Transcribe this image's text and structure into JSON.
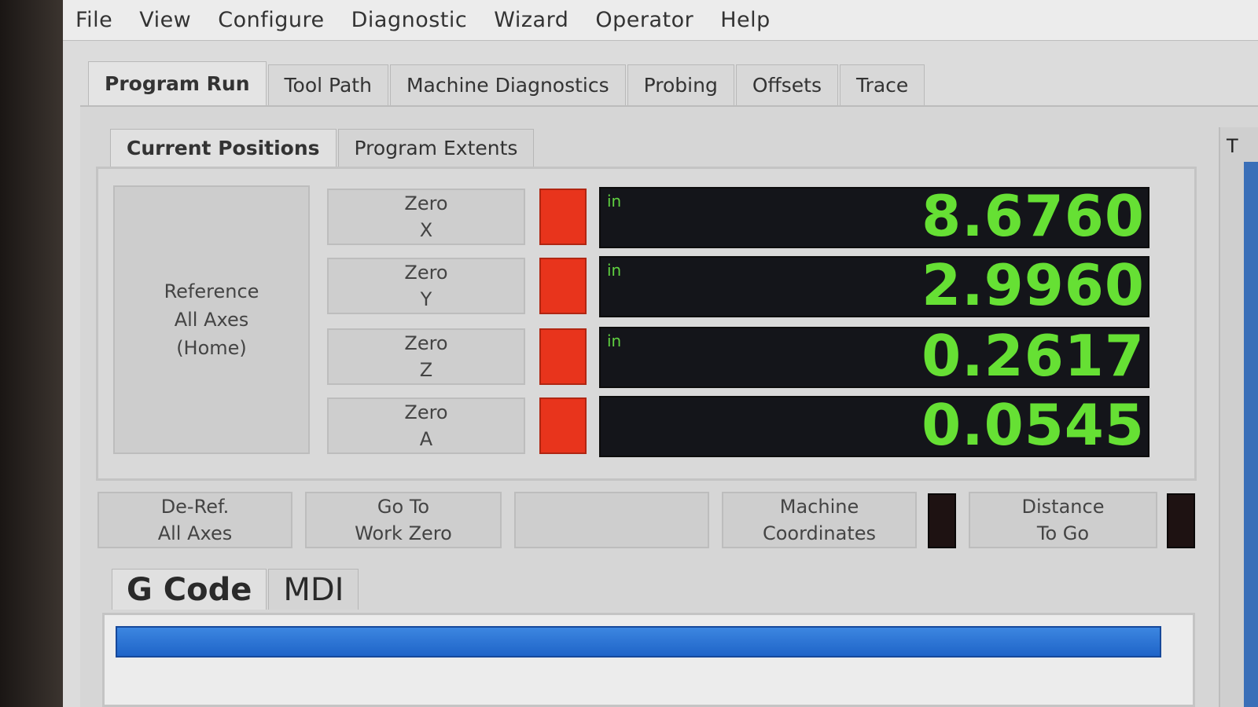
{
  "menu": [
    "File",
    "View",
    "Configure",
    "Diagnostic",
    "Wizard",
    "Operator",
    "Help"
  ],
  "outer_tabs": [
    "Program Run",
    "Tool Path",
    "Machine Diagnostics",
    "Probing",
    "Offsets",
    "Trace"
  ],
  "inner_tabs": [
    "Current Positions",
    "Program Extents"
  ],
  "reference_button": {
    "line1": "Reference",
    "line2": "All Axes",
    "line3": "(Home)"
  },
  "axes": [
    {
      "zero_label": "Zero",
      "axis": "X",
      "unit": "in",
      "value": "8.6760"
    },
    {
      "zero_label": "Zero",
      "axis": "Y",
      "unit": "in",
      "value": "2.9960"
    },
    {
      "zero_label": "Zero",
      "axis": "Z",
      "unit": "in",
      "value": "0.2617"
    },
    {
      "zero_label": "Zero",
      "axis": "A",
      "unit": "",
      "value": "0.0545"
    }
  ],
  "bottom_buttons": {
    "deref": {
      "line1": "De-Ref.",
      "line2": "All Axes"
    },
    "goto": {
      "line1": "Go To",
      "line2": "Work Zero"
    },
    "machine": {
      "line1": "Machine",
      "line2": "Coordinates"
    },
    "distance": {
      "line1": "Distance",
      "line2": "To Go"
    }
  },
  "gcode_tabs": [
    "G Code",
    "MDI"
  ],
  "right_strip_letter": "T",
  "colors": {
    "led_red": "#e8341c",
    "dro_text": "#66e034",
    "highlight": "#1f64c8"
  }
}
